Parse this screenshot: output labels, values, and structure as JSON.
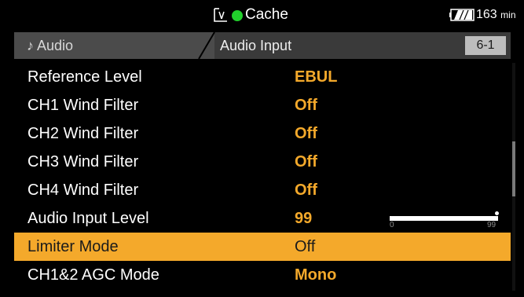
{
  "status": {
    "media_icon": "media-card-icon",
    "record_indicator_color": "#21d02c",
    "cache_label": "Cache",
    "battery_icon": "battery-icon",
    "battery_value": "163",
    "battery_unit": "min"
  },
  "header": {
    "breadcrumb_icon": "music-note-icon",
    "breadcrumb_parent": "Audio",
    "breadcrumb_current": "Audio Input",
    "page_number": "6-1"
  },
  "menu": {
    "items": [
      {
        "label": "Reference Level",
        "value": "EBUL",
        "selected": false
      },
      {
        "label": "CH1 Wind Filter",
        "value": "Off",
        "selected": false
      },
      {
        "label": "CH2 Wind Filter",
        "value": "Off",
        "selected": false
      },
      {
        "label": "CH3 Wind Filter",
        "value": "Off",
        "selected": false
      },
      {
        "label": "CH4 Wind Filter",
        "value": "Off",
        "selected": false
      },
      {
        "label": "Audio Input Level",
        "value": "99",
        "selected": false,
        "slider": {
          "min": "0",
          "max": "99",
          "level": 1.0
        }
      },
      {
        "label": "Limiter Mode",
        "value": "Off",
        "selected": true
      },
      {
        "label": "CH1&2 AGC Mode",
        "value": "Mono",
        "selected": false
      }
    ]
  },
  "colors": {
    "accent": "#f4a92b",
    "background": "#000000",
    "header_bg": "#3a3a3a"
  }
}
